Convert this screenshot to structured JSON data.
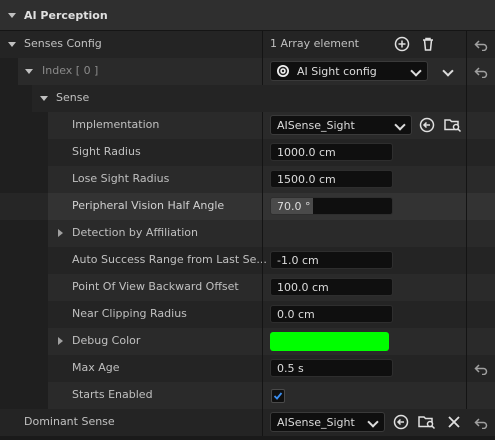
{
  "header": {
    "title": "AI Perception"
  },
  "senses_config": {
    "label": "Senses Config",
    "value": "1 Array element"
  },
  "index": {
    "label": "Index [ 0 ]",
    "value": "AI Sight config"
  },
  "sense": {
    "label": "Sense"
  },
  "properties": {
    "implementation": {
      "label": "Implementation",
      "value": "AISense_Sight"
    },
    "sight_radius": {
      "label": "Sight Radius",
      "value": "1000.0 cm"
    },
    "lose_sight_radius": {
      "label": "Lose Sight Radius",
      "value": "1500.0 cm"
    },
    "peripheral": {
      "label": "Peripheral Vision Half Angle",
      "value": "70.0 °"
    },
    "detection": {
      "label": "Detection by Affiliation"
    },
    "auto_success": {
      "label": "Auto Success Range from Last Se...",
      "value": "-1.0 cm"
    },
    "pov_offset": {
      "label": "Point Of View Backward Offset",
      "value": "100.0 cm"
    },
    "near_clip": {
      "label": "Near Clipping Radius",
      "value": "0.0 cm"
    },
    "debug_color": {
      "label": "Debug Color",
      "color": "#00ff00"
    },
    "max_age": {
      "label": "Max Age",
      "value": "0.5 s"
    },
    "starts_enabled": {
      "label": "Starts Enabled",
      "checked": true
    }
  },
  "dominant_sense": {
    "label": "Dominant Sense",
    "value": "AISense_Sight"
  }
}
